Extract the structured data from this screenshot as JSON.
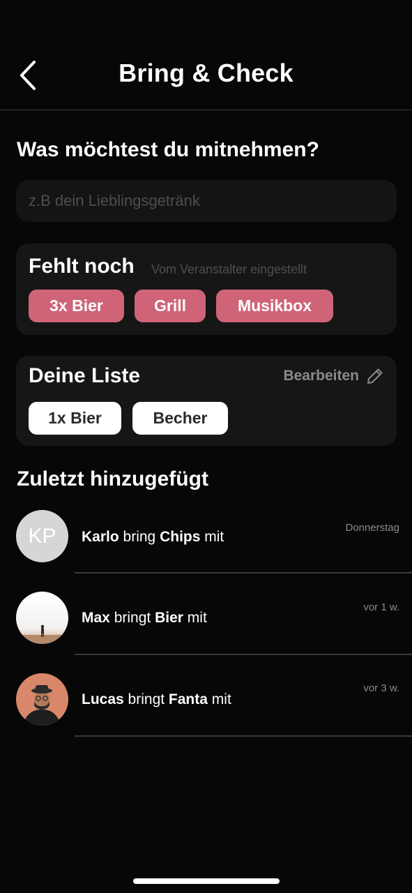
{
  "header": {
    "title": "Bring & Check",
    "back_icon": "chevron-left-icon"
  },
  "question": {
    "title": "Was möchtest du mitnehmen?",
    "input_placeholder": "z.B dein Lieblingsgetränk",
    "input_value": ""
  },
  "missing": {
    "title": "Fehlt noch",
    "subtitle": "Vom Veranstalter eingestellt",
    "chips": [
      "3x Bier",
      "Grill",
      "Musikbox"
    ],
    "chip_color": "#cf6478"
  },
  "my_list": {
    "title": "Deine Liste",
    "edit_label": "Bearbeiten",
    "edit_icon": "pencil-icon",
    "chips": [
      "1x Bier",
      "Becher"
    ]
  },
  "recent": {
    "title": "Zuletzt hinzugefügt",
    "items": [
      {
        "initials": "KP",
        "name": "Karlo",
        "verb": "bring",
        "item": "Chips",
        "suffix": "mit",
        "time": "Donnerstag"
      },
      {
        "name": "Max",
        "verb": "bringt",
        "item": "Bier",
        "suffix": "mit",
        "time": "vor 1 w."
      },
      {
        "name": "Lucas",
        "verb": "bringt",
        "item": "Fanta",
        "suffix": "mit",
        "time": "vor 3 w."
      }
    ]
  }
}
